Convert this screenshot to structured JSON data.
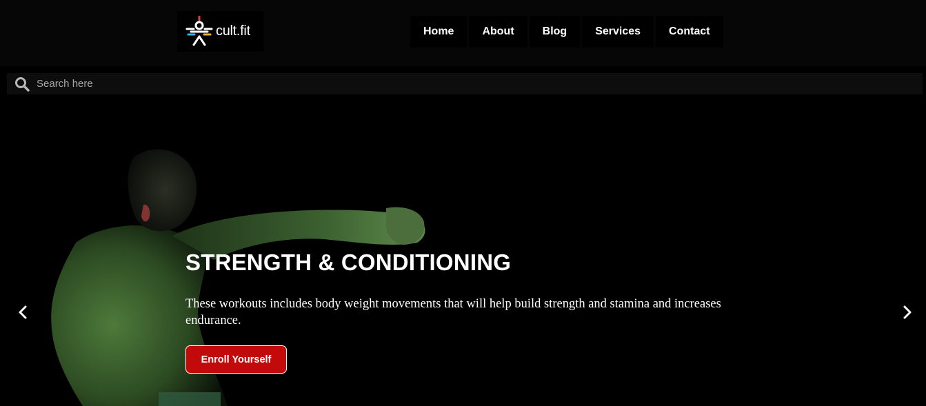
{
  "brand": {
    "logo_text": "cult.fit",
    "colors": {
      "ray_red": "#e0413c",
      "ray_blue": "#3fb4e8",
      "ray_yellow": "#f2b02a",
      "ray_white": "#ffffff"
    }
  },
  "nav": {
    "items": [
      {
        "label": "Home"
      },
      {
        "label": "About"
      },
      {
        "label": "Blog"
      },
      {
        "label": "Services"
      },
      {
        "label": "Contact"
      }
    ]
  },
  "search": {
    "icon": "search-icon",
    "placeholder": "Search here",
    "value": ""
  },
  "hero": {
    "title": "STRENGTH & CONDITIONING",
    "description": "These workouts includes body weight movements that will help build strength and stamina and increases endurance.",
    "cta_label": "Enroll Yourself",
    "cta_color": "#c20a0a",
    "prev_icon": "chevron-left-icon",
    "next_icon": "chevron-right-icon"
  }
}
